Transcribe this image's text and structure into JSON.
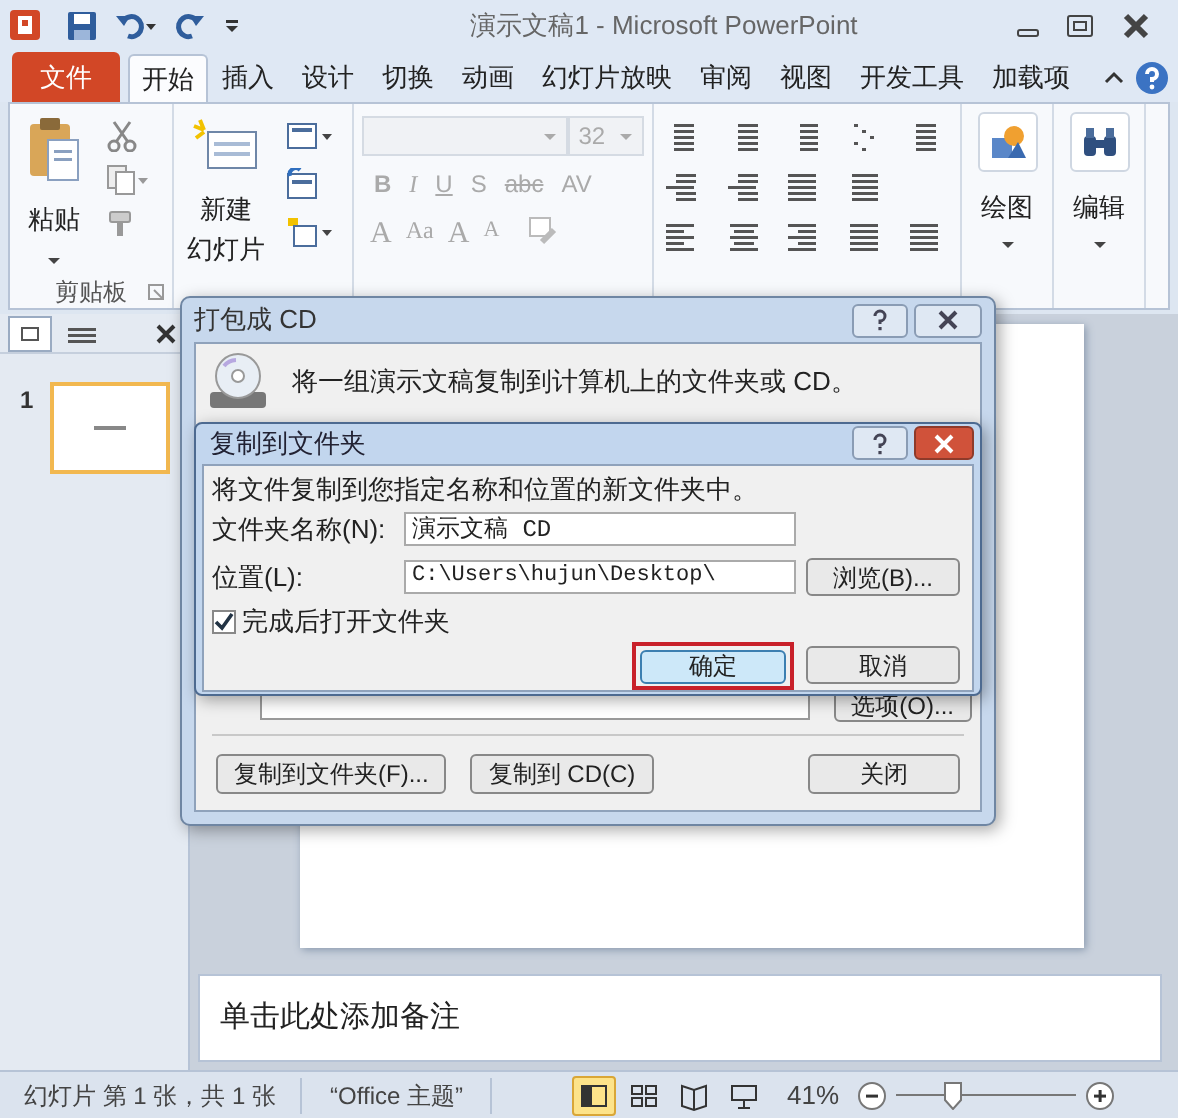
{
  "window": {
    "title": "演示文稿1 - Microsoft PowerPoint"
  },
  "tabs": [
    {
      "label": "文件",
      "kind": "file",
      "selected": false
    },
    {
      "label": "开始",
      "kind": "tab",
      "selected": true
    },
    {
      "label": "插入",
      "kind": "tab",
      "selected": false
    },
    {
      "label": "设计",
      "kind": "tab",
      "selected": false
    },
    {
      "label": "切换",
      "kind": "tab",
      "selected": false
    },
    {
      "label": "动画",
      "kind": "tab",
      "selected": false
    },
    {
      "label": "幻灯片放映",
      "kind": "tab",
      "selected": false
    },
    {
      "label": "审阅",
      "kind": "tab",
      "selected": false
    },
    {
      "label": "视图",
      "kind": "tab",
      "selected": false
    },
    {
      "label": "开发工具",
      "kind": "tab",
      "selected": false
    },
    {
      "label": "加载项",
      "kind": "tab",
      "selected": false
    }
  ],
  "ribbon": {
    "paste_label": "粘贴",
    "clipboard_label": "剪贴板",
    "new_slide_label": [
      "新建",
      "幻灯片"
    ],
    "font_size": "32",
    "font_row_1": [
      "B",
      "I",
      "U",
      "S",
      "abc",
      "AV"
    ],
    "font_row_2": [
      "A",
      "Aa",
      "A",
      "A"
    ],
    "drawing_label": "绘图",
    "editing_label": "编辑"
  },
  "slides_panel": {
    "slides": [
      {
        "number": "1",
        "selected": true
      }
    ]
  },
  "notes": {
    "placeholder": "单击此处添加备注"
  },
  "status_bar": {
    "slide_info": "幻灯片 第 1 张，共 1 张",
    "theme": "“Office 主题”",
    "views": [
      {
        "kind": "normal",
        "selected": true
      },
      {
        "kind": "sorter",
        "selected": false
      },
      {
        "kind": "reading",
        "selected": false
      },
      {
        "kind": "show",
        "selected": false
      }
    ],
    "zoom": "41%",
    "zoom_slider": {
      "level": 0.3
    }
  },
  "package_dialog": {
    "title": "打包成 CD",
    "description": "将一组演示文稿复制到计算机上的文件夹或 CD。",
    "options_button": "选项(O)...",
    "buttons": [
      "复制到文件夹(F)...",
      "复制到 CD(C)",
      "关闭"
    ]
  },
  "copy_dialog": {
    "title": "复制到文件夹",
    "instruction": "将文件复制到您指定名称和位置的新文件夹中。",
    "name_label": "文件夹名称(N):",
    "name_value": "演示文稿 CD",
    "location_label": "位置(L):",
    "location_value": "C:\\Users\\hujun\\Desktop\\",
    "browse_button": "浏览(B)...",
    "open_after": {
      "label": "完成后打开文件夹",
      "checked": true
    },
    "ok_button": {
      "label": "确定",
      "highlighted": true
    },
    "cancel_button": "取消"
  }
}
